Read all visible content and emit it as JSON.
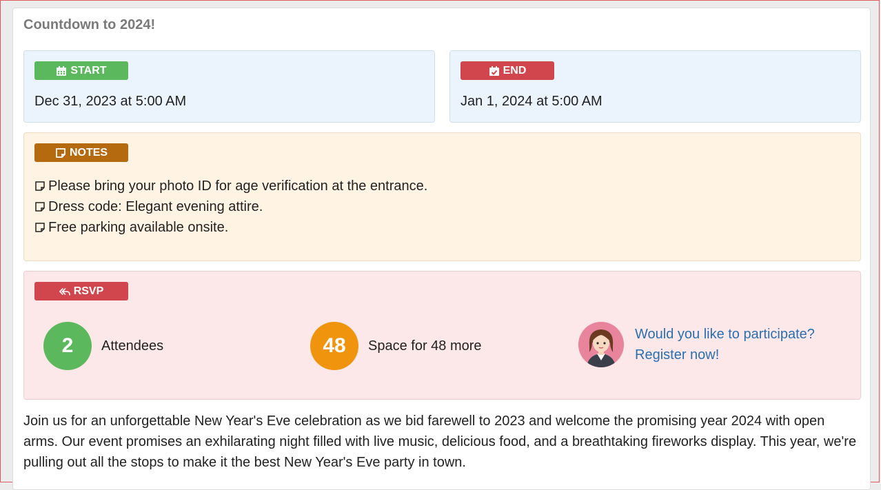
{
  "page_title": "Countdown to 2024!",
  "start": {
    "label": "START",
    "icon": "calendar-icon",
    "value": "Dec 31, 2023 at 5:00 AM",
    "color": "#5cb85c"
  },
  "end": {
    "label": "END",
    "icon": "calendar-check-icon",
    "value": "Jan 1, 2024 at 5:00 AM",
    "color": "#d0464c"
  },
  "notes": {
    "label": "NOTES",
    "icon": "sticky-note-icon",
    "color": "#b56a0f",
    "items": [
      "Please bring your photo ID for age verification at the entrance.",
      "Dress code: Elegant evening attire.",
      "Free parking available onsite."
    ]
  },
  "rsvp": {
    "label": "RSVP",
    "icon": "reply-all-icon",
    "color": "#d0464c",
    "attendees": {
      "count": "2",
      "text": "Attendees",
      "color": "#5cb85c"
    },
    "space": {
      "count": "48",
      "text": "Space for 48 more",
      "color": "#f0930d"
    },
    "cta": {
      "line1": "Would you like to participate?",
      "line2": "Register now!",
      "color": "#2a6fb0"
    }
  },
  "description": "Join us for an unforgettable New Year's Eve celebration as we bid farewell to 2023 and welcome the promising year 2024 with open arms. Our event promises an exhilarating night filled with live music, delicious food, and a breathtaking fireworks display. This year, we're pulling out all the stops to make it the best New Year's Eve party in town."
}
